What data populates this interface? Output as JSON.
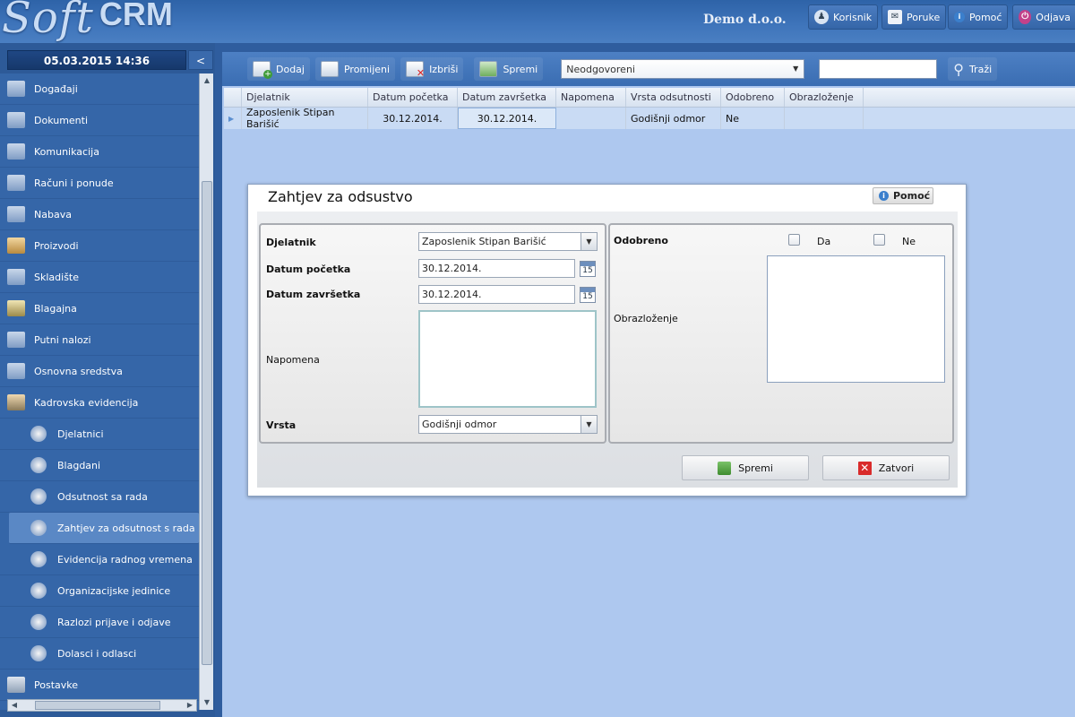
{
  "header": {
    "logo_soft": "Soft",
    "logo_crm": "CRM",
    "company": "Demo d.o.o.",
    "buttons": [
      {
        "label": "Korisnik",
        "icon": "user-icon"
      },
      {
        "label": "Poruke",
        "icon": "mail-icon"
      },
      {
        "label": "Pomoć",
        "icon": "info-icon"
      },
      {
        "label": "Odjava",
        "icon": "power-icon"
      }
    ]
  },
  "sidebar": {
    "datetime": "05.03.2015 14:36",
    "collapse_label": "<",
    "items": [
      {
        "label": "Događaji"
      },
      {
        "label": "Dokumenti"
      },
      {
        "label": "Komunikacija"
      },
      {
        "label": "Računi i ponude"
      },
      {
        "label": "Nabava"
      },
      {
        "label": "Proizvodi"
      },
      {
        "label": "Skladište"
      },
      {
        "label": "Blagajna"
      },
      {
        "label": "Putni nalozi"
      },
      {
        "label": "Osnovna sredstva"
      },
      {
        "label": "Kadrovska evidencija"
      }
    ],
    "subitems": [
      {
        "label": "Djelatnici"
      },
      {
        "label": "Blagdani"
      },
      {
        "label": "Odsutnost sa rada"
      },
      {
        "label": "Zahtjev za odsutnost s rada"
      },
      {
        "label": "Evidencija radnog vremena"
      },
      {
        "label": "Organizacijske jedinice"
      },
      {
        "label": "Razlozi prijave i odjave"
      },
      {
        "label": "Dolasci i odlasci"
      }
    ],
    "last_item": {
      "label": "Postavke"
    }
  },
  "toolbar": {
    "add": "Dodaj",
    "edit": "Promijeni",
    "delete": "Izbriši",
    "save": "Spremi",
    "filter_value": "Neodgovoreni",
    "search_value": "",
    "search_button": "Traži"
  },
  "grid": {
    "columns": [
      "Djelatnik",
      "Datum početka",
      "Datum završetka",
      "Napomena",
      "Vrsta odsutnosti",
      "Odobreno",
      "Obrazloženje"
    ],
    "rows": [
      [
        "Zaposlenik Stipan Barišić",
        "30.12.2014.",
        "30.12.2014.",
        "",
        "Godišnji odmor",
        "Ne",
        ""
      ]
    ]
  },
  "dialog": {
    "title": "Zahtjev za odsustvo",
    "help": "Pomoć",
    "employee_label": "Djelatnik",
    "employee_value": "Zaposlenik Stipan Barišić",
    "start_label": "Datum početka",
    "start_value": "30.12.2014.",
    "end_label": "Datum završetka",
    "end_value": "30.12.2014.",
    "calendar_day": "15",
    "note_label": "Napomena",
    "note_value": "",
    "type_label": "Vrsta",
    "type_value": "Godišnji odmor",
    "approved_label": "Odobreno",
    "yes_label": "Da",
    "no_label": "Ne",
    "yes_checked": false,
    "no_checked": false,
    "reason_label": "Obrazloženje",
    "reason_value": "",
    "save_button": "Spremi",
    "close_button": "Zatvori"
  }
}
